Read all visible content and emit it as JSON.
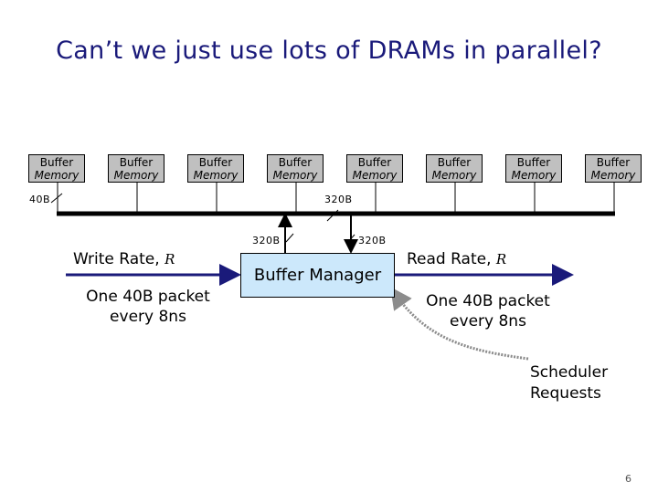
{
  "slide": {
    "title": "Can’t we just use lots of DRAMs in parallel?",
    "page_number": "6"
  },
  "memories": [
    {
      "line1": "Buffer",
      "line2": "Memory"
    },
    {
      "line1": "Buffer",
      "line2": "Memory"
    },
    {
      "line1": "Buffer",
      "line2": "Memory"
    },
    {
      "line1": "Buffer",
      "line2": "Memory"
    },
    {
      "line1": "Buffer",
      "line2": "Memory"
    },
    {
      "line1": "Buffer",
      "line2": "Memory"
    },
    {
      "line1": "Buffer",
      "line2": "Memory"
    },
    {
      "line1": "Buffer",
      "line2": "Memory"
    }
  ],
  "bus_labels": {
    "per_memory_width": "40B",
    "bus_width": "320B",
    "write_path_width": "320B",
    "read_path_width": "320B"
  },
  "buffer_manager": {
    "label": "Buffer Manager"
  },
  "write": {
    "label": "Write Rate, ",
    "var": "R",
    "note_line1": "One 40B packet",
    "note_line2": "every 8ns"
  },
  "read": {
    "label": "Read Rate, ",
    "var": "R",
    "note_line1": "One 40B packet",
    "note_line2": "every 8ns"
  },
  "scheduler": {
    "line1": "Scheduler",
    "line2": "Requests"
  },
  "colors": {
    "title": "#1a1a7a",
    "arrow": "#1a1a7a",
    "memory_fill": "#c0c0c0",
    "manager_fill": "#cce8fb",
    "scheduler_arrow": "#8c8c8c"
  }
}
